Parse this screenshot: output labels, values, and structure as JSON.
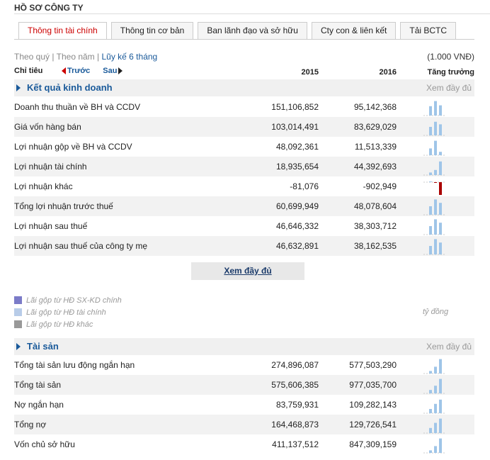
{
  "header": {
    "title": "HỒ SƠ CÔNG TY"
  },
  "tabs": [
    {
      "label": "Thông tin tài chính",
      "active": true
    },
    {
      "label": "Thông tin cơ bản",
      "active": false
    },
    {
      "label": "Ban lãnh đạo và sở hữu",
      "active": false
    },
    {
      "label": "Cty con & liên kết",
      "active": false
    },
    {
      "label": "Tải BCTC",
      "active": false
    }
  ],
  "period": {
    "quarter": "Theo quý",
    "year": "Theo năm",
    "accum": "Lũy kế 6 tháng",
    "sep": "|"
  },
  "unit": "(1.000 VNĐ)",
  "columns": {
    "label": "Chỉ tiêu",
    "prev": "Trước",
    "next": "Sau",
    "y1": "2015",
    "y2": "2016",
    "growth": "Tăng trưởng"
  },
  "sections": {
    "kqkd": {
      "title": "Kết quả kinh doanh",
      "more": "Xem đầy đủ",
      "rows": [
        {
          "label": "Doanh thu thuần về BH và CCDV",
          "v1": "151,106,852",
          "v2": "95,142,368",
          "spark": [
            0.55,
            0.85,
            0.6
          ]
        },
        {
          "label": "Giá vốn hàng bán",
          "v1": "103,014,491",
          "v2": "83,629,029",
          "spark": [
            0.5,
            0.8,
            0.65
          ]
        },
        {
          "label": "Lợi nhuận gộp về BH và CCDV",
          "v1": "48,092,361",
          "v2": "11,513,339",
          "spark": [
            0.4,
            0.85,
            0.2
          ]
        },
        {
          "label": "Lợi nhuận tài chính",
          "v1": "18,935,654",
          "v2": "44,392,693",
          "spark": [
            0.15,
            0.3,
            0.8
          ]
        },
        {
          "label": "Lợi nhuận khác",
          "v1": "-81,076",
          "v2": "-902,949",
          "spark": [
            0.05,
            -0.05,
            -0.9
          ]
        },
        {
          "label": "Tổng lợi nhuận trước thuế",
          "v1": "60,699,949",
          "v2": "48,078,604",
          "spark": [
            0.5,
            0.9,
            0.7
          ]
        },
        {
          "label": "Lợi nhuận sau thuế",
          "v1": "46,646,332",
          "v2": "38,303,712",
          "spark": [
            0.5,
            0.9,
            0.7
          ]
        },
        {
          "label": "Lợi nhuận sau thuế của công ty mẹ",
          "v1": "46,632,891",
          "v2": "38,162,535",
          "spark": [
            0.5,
            0.9,
            0.7
          ]
        }
      ]
    },
    "more_button": "Xem đầy đủ",
    "legend": [
      {
        "label": "Lãi gộp từ HĐ SX-KD chính",
        "color": "#7b7bc8"
      },
      {
        "label": "Lãi gộp từ HĐ tài chính",
        "color": "#b8cce8"
      },
      {
        "label": "Lãi gộp từ HĐ khác",
        "color": "#999999"
      }
    ],
    "legend_unit": "tỷ đồng",
    "taisan": {
      "title": "Tài sản",
      "more": "Xem đầy đủ",
      "rows": [
        {
          "label": "Tổng tài sản lưu động ngắn hạn",
          "v1": "274,896,087",
          "v2": "577,503,290",
          "spark": [
            0.15,
            0.4,
            0.85
          ]
        },
        {
          "label": "Tổng tài sản",
          "v1": "575,606,385",
          "v2": "977,035,700",
          "spark": [
            0.2,
            0.45,
            0.85
          ]
        },
        {
          "label": "Nợ ngắn hạn",
          "v1": "83,759,931",
          "v2": "109,282,143",
          "spark": [
            0.25,
            0.55,
            0.8
          ]
        },
        {
          "label": "Tổng nợ",
          "v1": "164,468,873",
          "v2": "129,726,541",
          "spark": [
            0.3,
            0.6,
            0.85
          ]
        },
        {
          "label": "Vốn chủ sở hữu",
          "v1": "411,137,512",
          "v2": "847,309,159",
          "spark": [
            0.15,
            0.4,
            0.85
          ]
        }
      ]
    }
  },
  "colors": {
    "accent": "#1a5a9a",
    "active_tab": "#cc0000",
    "spark_pos": "#9fc5e8",
    "spark_neg": "#aa0000"
  }
}
